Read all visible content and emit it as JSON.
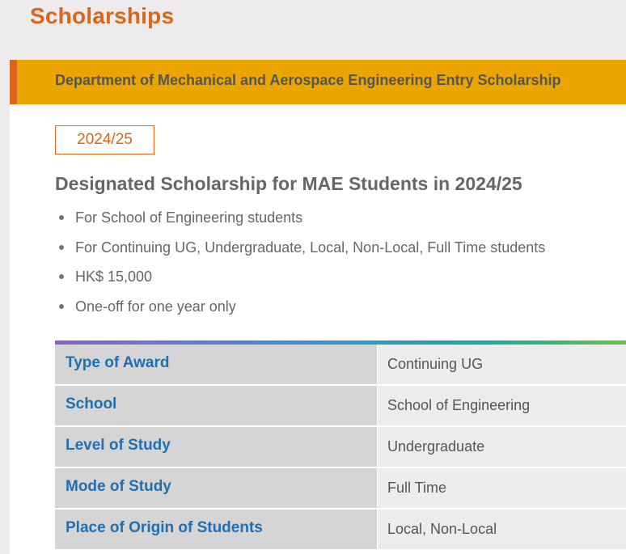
{
  "page": {
    "title": "Scholarships"
  },
  "scholarship": {
    "header_title": "Department of Mechanical and Aerospace Engineering Entry Scholarship",
    "year": "2024/25",
    "title": "Designated Scholarship for MAE Students in 2024/25",
    "bullets": [
      "For School of Engineering students",
      "For Continuing UG, Undergraduate, Local, Non-Local, Full Time students",
      "HK$ 15,000",
      "One-off for one year only"
    ],
    "details": [
      {
        "label": "Type of Award",
        "value": "Continuing UG"
      },
      {
        "label": "School",
        "value": "School of Engineering"
      },
      {
        "label": "Level of Study",
        "value": "Undergraduate"
      },
      {
        "label": "Mode of Study",
        "value": "Full Time"
      },
      {
        "label": "Place of Origin of Students",
        "value": "Local, Non-Local"
      }
    ]
  },
  "colors": {
    "accent_orange": "#d9661a",
    "header_gold": "#eaa500",
    "label_blue": "#1f6fb4",
    "page_background": "#ececec"
  }
}
